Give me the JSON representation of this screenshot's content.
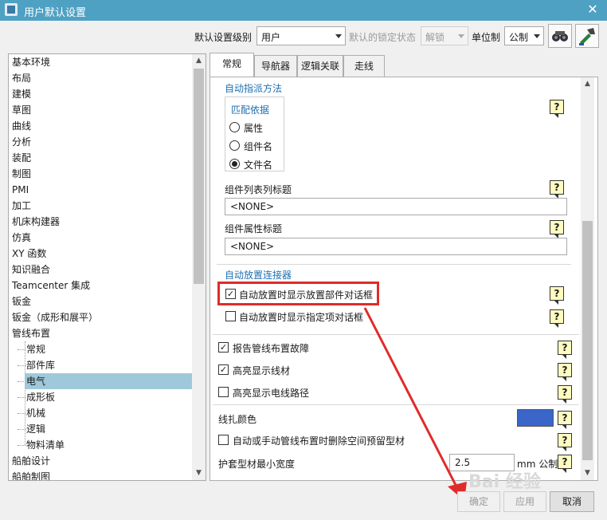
{
  "window": {
    "title": "用户默认设置",
    "close_glyph": "✕"
  },
  "toolbar": {
    "level_label": "默认设置级别",
    "level_value": "用户",
    "lock_label": "默认的锁定状态",
    "lock_value": "解锁",
    "unit_label": "单位制",
    "unit_value": "公制"
  },
  "tree": {
    "items": [
      "基本环境",
      "布局",
      "建模",
      "草图",
      "曲线",
      "分析",
      "装配",
      "制图",
      "PMI",
      "加工",
      "机床构建器",
      "仿真",
      "XY 函数",
      "知识融合",
      "Teamcenter 集成",
      "钣金",
      "钣金（成形和展平）",
      "管线布置"
    ],
    "children": [
      "常规",
      "部件库",
      "电气",
      "成形板",
      "机械",
      "逻辑",
      "物料清单"
    ],
    "after": [
      "船舶设计",
      "船舶制图"
    ],
    "selected": "电气"
  },
  "tabs": [
    "常规",
    "导航器",
    "逻辑关联",
    "走线"
  ],
  "content": {
    "sec1": "自动指派方法",
    "match_group": "匹配依据",
    "radio_attr": "属性",
    "radio_compname": "组件名",
    "radio_filename": "文件名",
    "list_title_label": "组件列表列标题",
    "list_title_value": "<NONE>",
    "attr_title_label": "组件属性标题",
    "attr_title_value": "<NONE>",
    "sec2": "自动放置连接器",
    "cb_show_dialog": "自动放置时显示放置部件对话框",
    "cb_show_designated": "自动放置时显示指定项对话框",
    "cb_report": "报告管线布置故障",
    "cb_highlight": "高亮显示线材",
    "cb_highlight_path": "高亮显示电线路径",
    "bundle_color_label": "线扎颜色",
    "bundle_color": "#3a66c9",
    "cb_delete_space": "自动或手动管线布置时删除空间预留型材",
    "sheath_label": "护套型材最小宽度",
    "sheath_value": "2.5",
    "sheath_unit": "mm 公制",
    "help_glyph": "?"
  },
  "buttons": {
    "ok": "确定",
    "apply": "应用",
    "cancel": "取消"
  },
  "watermark": "Bai 经验"
}
